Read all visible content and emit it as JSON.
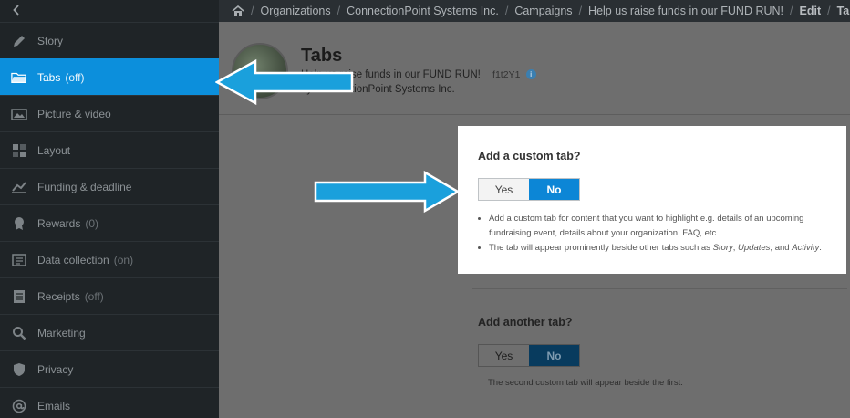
{
  "sidebar": {
    "back_icon": "chevron-left-icon",
    "items": [
      {
        "label": "Story",
        "suffix": "",
        "icon": "pencil-icon"
      },
      {
        "label": "Tabs",
        "suffix": "(off)",
        "icon": "folder-icon",
        "active": true
      },
      {
        "label": "Picture & video",
        "suffix": "",
        "icon": "image-icon"
      },
      {
        "label": "Layout",
        "suffix": "",
        "icon": "layout-icon"
      },
      {
        "label": "Funding & deadline",
        "suffix": "",
        "icon": "chart-icon"
      },
      {
        "label": "Rewards",
        "suffix": "(0)",
        "icon": "ribbon-icon"
      },
      {
        "label": "Data collection",
        "suffix": "(on)",
        "icon": "form-icon"
      },
      {
        "label": "Receipts",
        "suffix": "(off)",
        "icon": "receipt-icon"
      },
      {
        "label": "Marketing",
        "suffix": "",
        "icon": "search-icon"
      },
      {
        "label": "Privacy",
        "suffix": "",
        "icon": "shield-icon"
      },
      {
        "label": "Emails",
        "suffix": "",
        "icon": "at-icon"
      }
    ]
  },
  "breadcrumb": {
    "home_icon": "home-icon",
    "crumbs": [
      "Organizations",
      "ConnectionPoint Systems Inc.",
      "Campaigns",
      "Help us raise funds in our FUND RUN!",
      "Edit",
      "Tabs"
    ]
  },
  "header": {
    "title": "Tabs",
    "subtitle": "Help us raise funds in our FUND RUN!",
    "code": "f1t2Y1",
    "org_line": "by ConnectionPoint Systems Inc."
  },
  "custom_tab": {
    "question": "Add a custom tab?",
    "yes_label": "Yes",
    "no_label": "No",
    "selected": "No",
    "bullet_1": "Add a custom tab for content that you want to highlight e.g. details of an upcoming fundraising event, details about your organization, FAQ, etc.",
    "bullet_2_prefix": "The tab will appear prominently beside other tabs such as ",
    "bullet_2_story": "Story",
    "bullet_2_sep1": ", ",
    "bullet_2_updates": "Updates",
    "bullet_2_sep2": ", and ",
    "bullet_2_activity": "Activity",
    "bullet_2_end": "."
  },
  "another_tab": {
    "question": "Add another tab?",
    "yes_label": "Yes",
    "no_label": "No",
    "selected": "No",
    "note": "The second custom tab will appear beside the first."
  },
  "colors": {
    "accent": "#0c8fdc",
    "sidebar_bg": "#1f2427",
    "arrow": "#1aa0dc"
  }
}
